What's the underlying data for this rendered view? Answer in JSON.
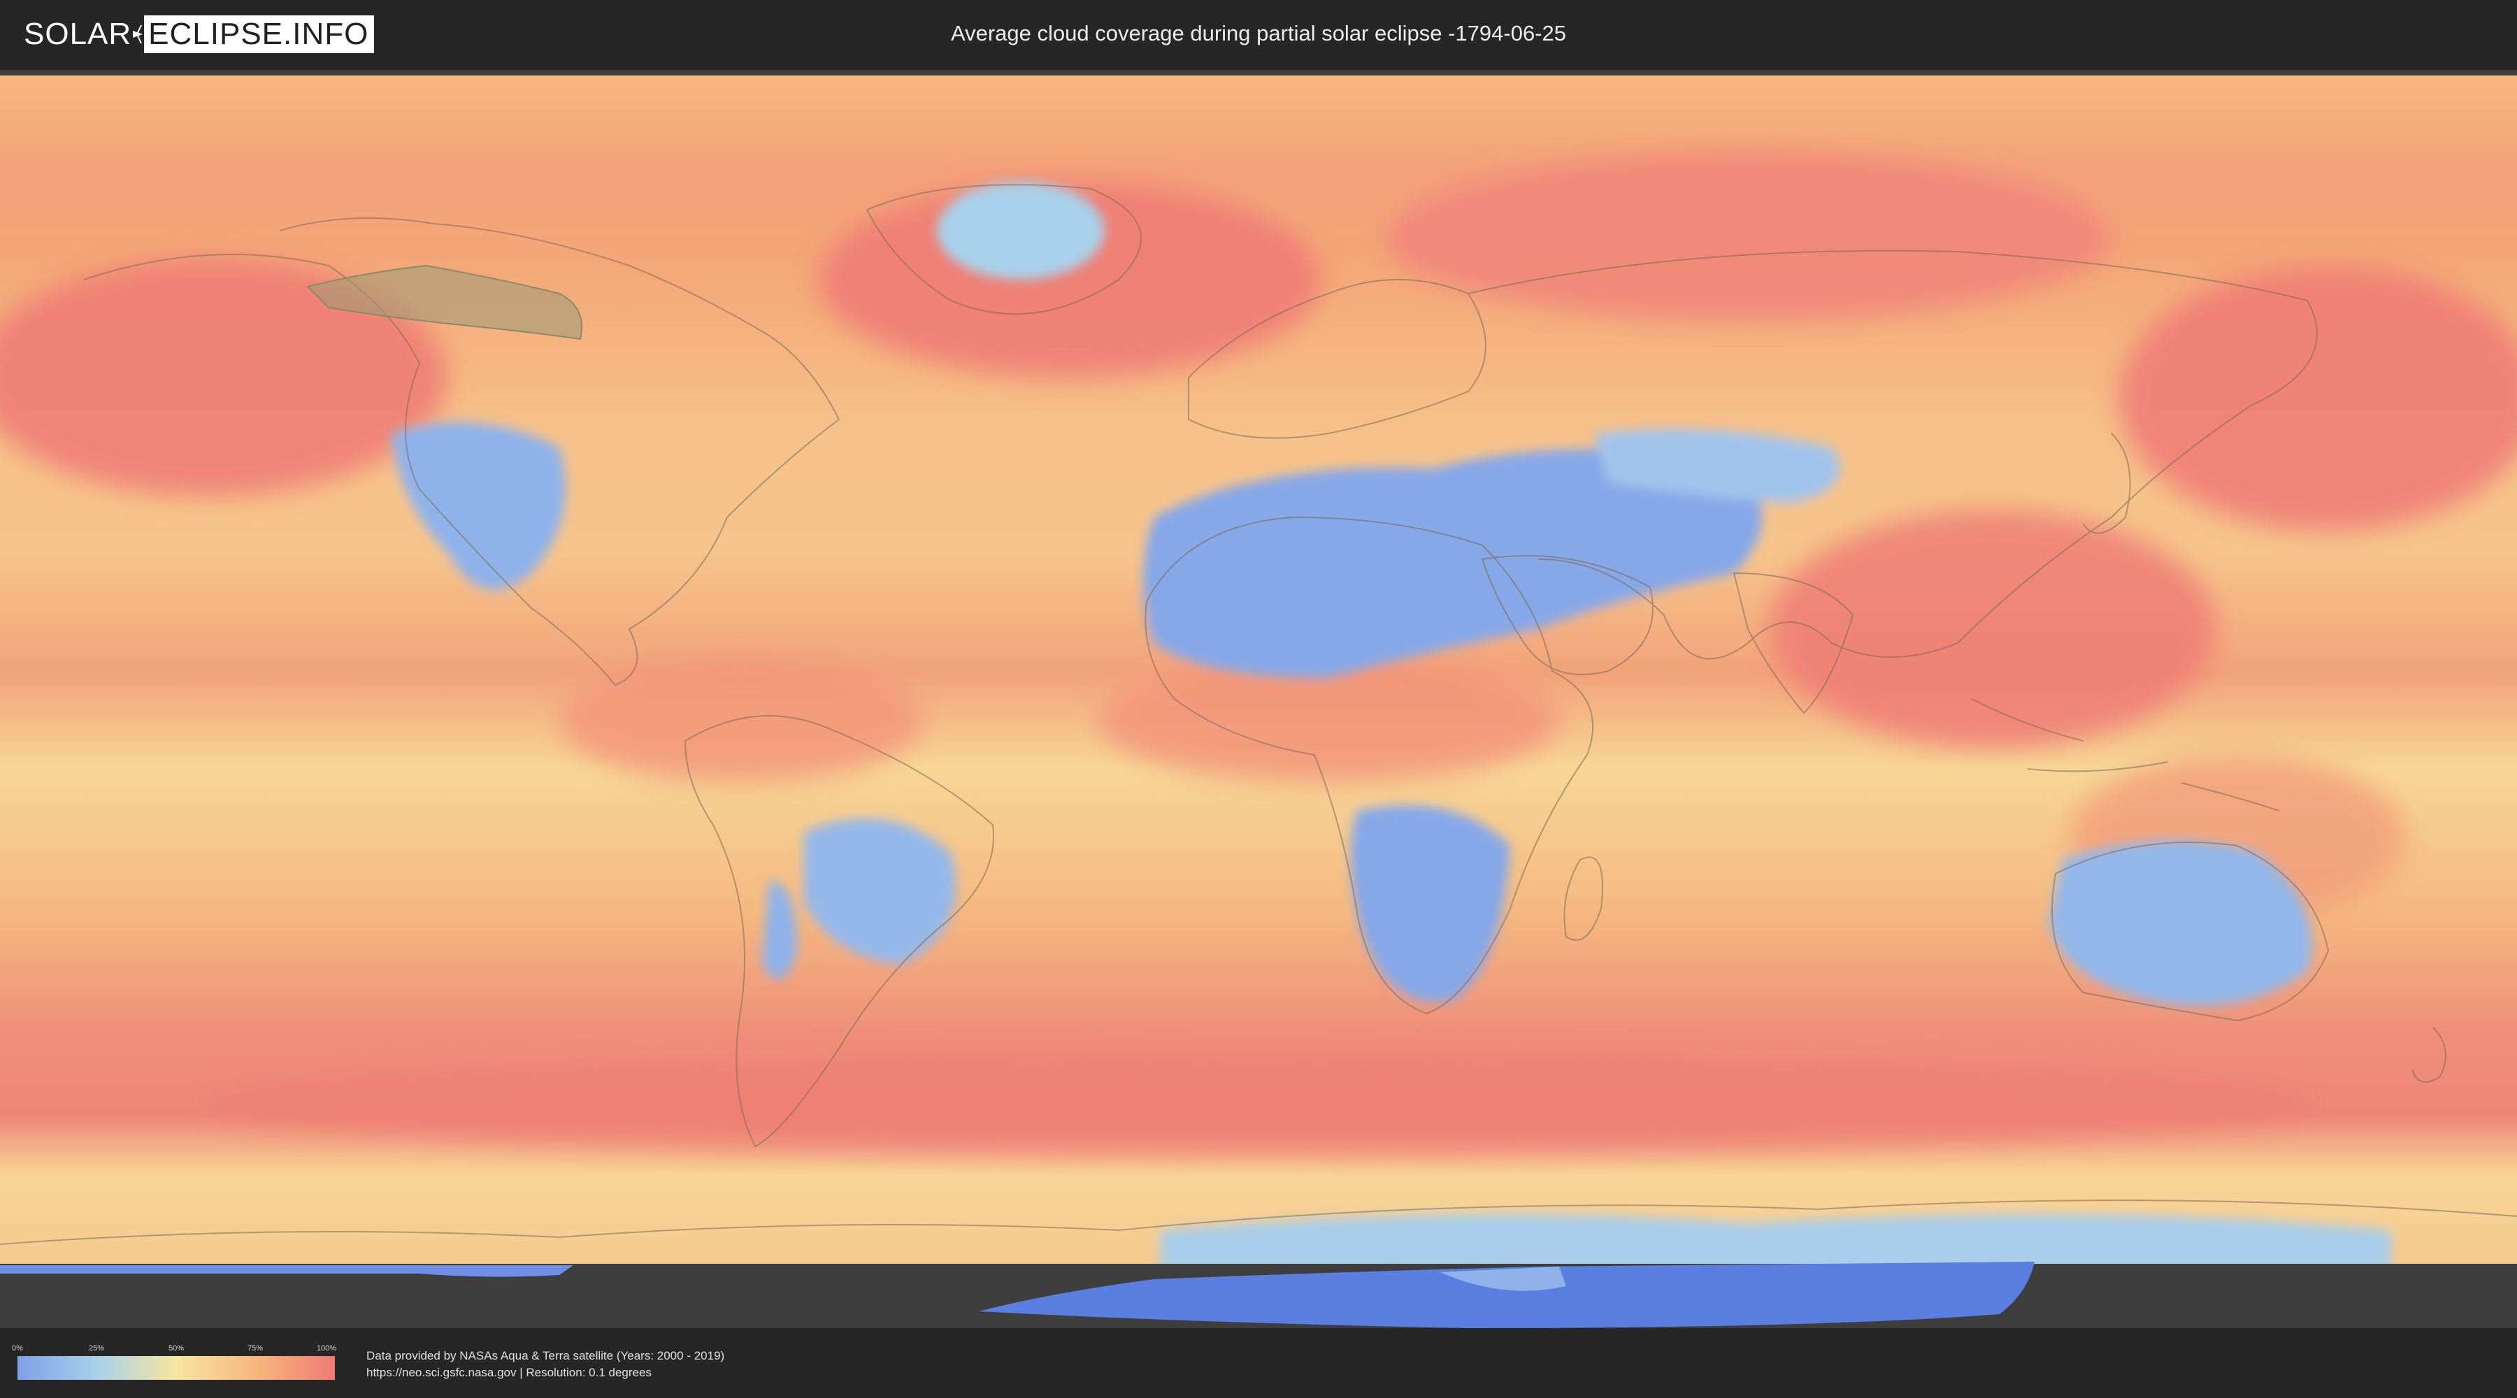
{
  "brand": {
    "part1": "SOLAR",
    "part2": "ECLIPSE.INFO"
  },
  "title": "Average cloud coverage during partial solar eclipse -1794-06-25",
  "map": {
    "alt": "World map of average cloud coverage",
    "eclipse_path_color": "#9a9a74",
    "colors": {
      "clear": "#7f9fe6",
      "low": "#a9d0ea",
      "mid": "#f7e5a0",
      "high": "#f6b77d",
      "overcast": "#ef7a74",
      "ice_shelf": "#5a7fe0",
      "border": "#7a6a55"
    }
  },
  "legend": {
    "ticks": [
      "0%",
      "25%",
      "50%",
      "75%",
      "100%"
    ],
    "tick_fractions": [
      0,
      0.25,
      0.5,
      0.75,
      1.0
    ]
  },
  "credits": {
    "line1": "Data provided by NASAs Aqua & Terra satellite (Years: 2000 - 2019)",
    "line2": "https://neo.sci.gsfc.nasa.gov | Resolution: 0.1 degrees"
  }
}
